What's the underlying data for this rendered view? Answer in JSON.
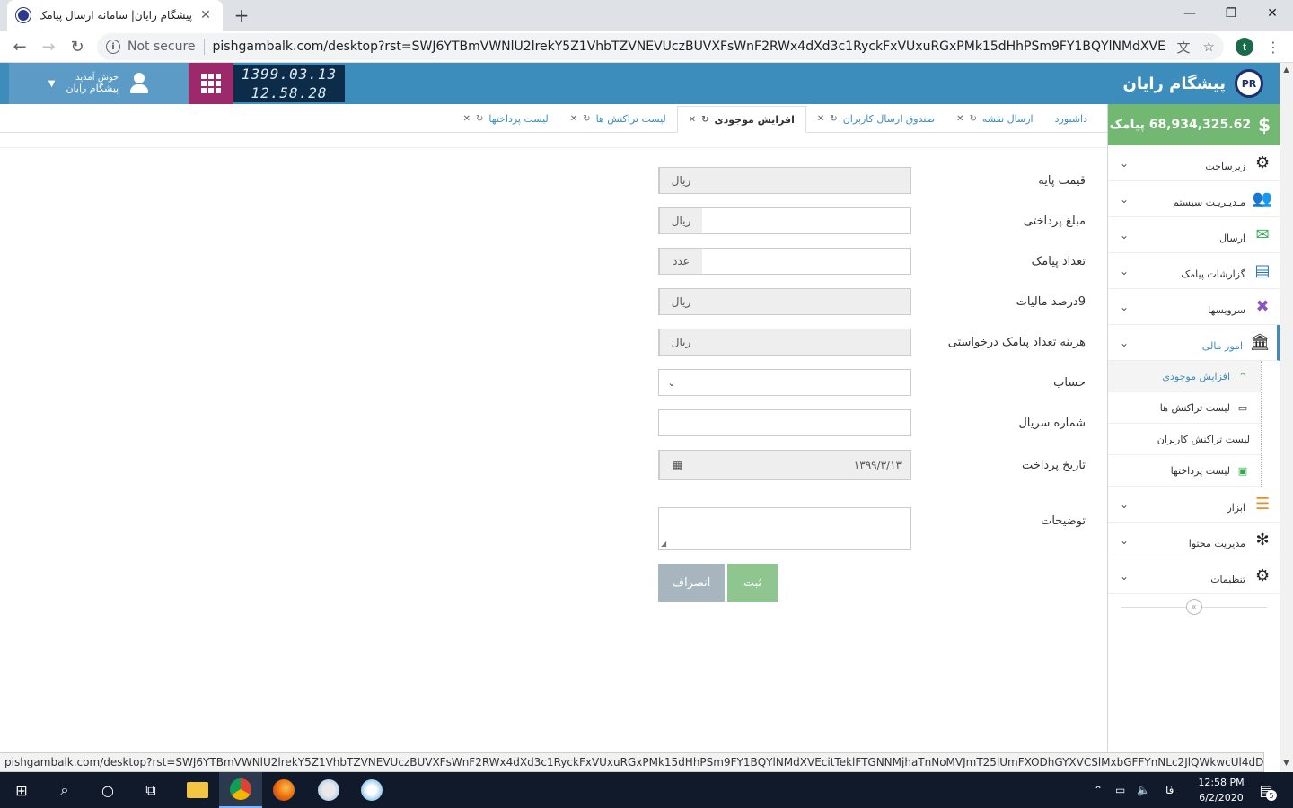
{
  "browser": {
    "tab_title": "پیشگام رایان| سامانه ارسال پیامک ان",
    "not_secure": "Not secure",
    "url": "pishgambalk.com/desktop?rst=SWJ6YTBmVWNlU2lrekY5Z1VhbTZVNEVUczBUVXFsWnF2RWx4dXd3c1RyckFxVUxuRGxPMk15dHhPSm9FY1BQYlNMdXVEcitTeklFTGNNMjha...",
    "profile_initial": "t"
  },
  "header": {
    "brand": "پیشگام رایان",
    "welcome": "خوش آمدید",
    "user_name": "پیشگام رایان",
    "date": "1399.03.13",
    "time": "12.58.28",
    "colors": {
      "header": "#3c8dbc",
      "apps": "#9c2a6a",
      "clock_bg": "#0d2c49"
    }
  },
  "tabs": [
    {
      "label": "داشبورد"
    },
    {
      "label": "ارسال نقشه"
    },
    {
      "label": "صندوق ارسال کاربران"
    },
    {
      "label": "افزایش موجودی"
    },
    {
      "label": "لیست تراکنش ها"
    },
    {
      "label": "لیست پرداختها"
    }
  ],
  "sidebar": {
    "balance": "68,934,325.62 پیامک",
    "items": [
      {
        "label": "زیرساخت",
        "icon": "cogs-icon"
      },
      {
        "label": "مـدیـریـت سیستم",
        "icon": "users-icon"
      },
      {
        "label": "ارسال",
        "icon": "envelope-icon"
      },
      {
        "label": "گزارشات پیامک",
        "icon": "file-icon"
      },
      {
        "label": "سرویسها",
        "icon": "services-icon"
      },
      {
        "label": "امور مالی",
        "icon": "bank-icon"
      },
      {
        "label": "ابزار",
        "icon": "bars-icon"
      },
      {
        "label": "مدیریت محتوا",
        "icon": "yelp-icon"
      },
      {
        "label": "تنظیمات",
        "icon": "gear-icon"
      }
    ],
    "submenu": [
      {
        "label": "افزایش موجودی"
      },
      {
        "label": "لیست تراکنش ها"
      },
      {
        "label": "لیست تراکنش کاربران"
      },
      {
        "label": "لیست پرداختها"
      }
    ]
  },
  "form": {
    "base_price": {
      "label": "قیمت پایه",
      "unit": "ریال",
      "value": ""
    },
    "payment_amount": {
      "label": "مبلغ پرداختی",
      "unit": "ریال",
      "value": ""
    },
    "sms_count": {
      "label": "تعداد پیامک",
      "unit": "عدد",
      "value": ""
    },
    "tax": {
      "label": "9درصد مالیات",
      "unit": "ریال",
      "value": ""
    },
    "cost": {
      "label": "هزینه تعداد پیامک درخواستی",
      "unit": "ریال",
      "value": ""
    },
    "account": {
      "label": "حساب",
      "value": ""
    },
    "serial": {
      "label": "شماره سریال",
      "value": ""
    },
    "payment_date": {
      "label": "تاریخ پرداخت",
      "value": "۱۳۹۹/۳/۱۳"
    },
    "description": {
      "label": "توضیحات",
      "value": ""
    },
    "submit_label": "ثبت",
    "cancel_label": "انصراف"
  },
  "status_url": "pishgambalk.com/desktop?rst=SWJ6YTBmVWNlU2lrekY5Z1VhbTZVNEVUczBUVXFsWnF2RWx4dXd3c1RyckFxVUxuRGxPMk15dHhPSm9FY1BQYlNMdXVEcitTeklFTGNNMjhaTnNoMVJmT25lUmFXODhGYXVCSlMxbGFFYnNLc2JlQWkwcUl4dDVOZk41ODhacnVlVDRXc...",
  "taskbar": {
    "time": "12:58 PM",
    "date": "6/2/2020",
    "language": "فا",
    "notifications": "5"
  }
}
